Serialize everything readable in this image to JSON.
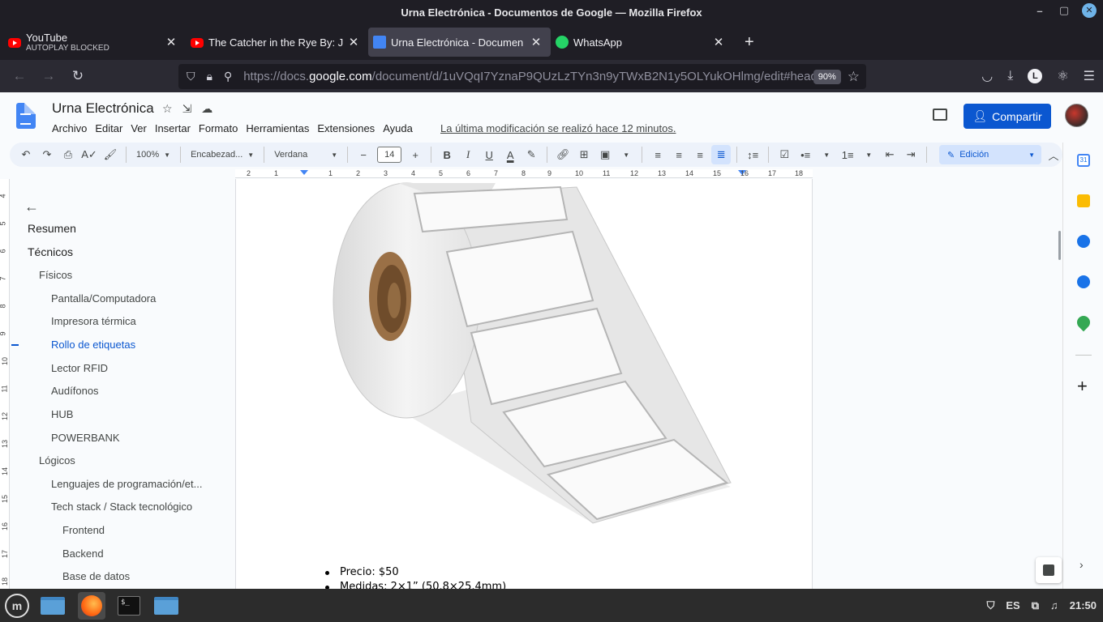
{
  "window": {
    "title": "Urna Electrónica - Documentos de Google — Mozilla Firefox"
  },
  "tabs": [
    {
      "title": "YouTube",
      "subtitle": "AUTOPLAY BLOCKED",
      "icon": "youtube-icon"
    },
    {
      "title": "The Catcher in the Rye By: J",
      "icon": "youtube-icon"
    },
    {
      "title": "Urna Electrónica - Documen",
      "icon": "google-docs-icon",
      "active": true
    },
    {
      "title": "WhatsApp",
      "icon": "whatsapp-icon"
    }
  ],
  "navbar": {
    "url_prefix": "https://docs.",
    "url_domain": "google.com",
    "url_rest": "/document/d/1uVQqI7YznaP9QUzLzTYn3n9yTWxB2N1y5OLYukOHlmg/edit#head",
    "zoom": "90%",
    "profile_initial": "L"
  },
  "docs": {
    "title": "Urna Electrónica",
    "menu": [
      "Archivo",
      "Editar",
      "Ver",
      "Insertar",
      "Formato",
      "Herramientas",
      "Extensiones",
      "Ayuda"
    ],
    "last_modified": "La última modificación se realizó hace 12 minutos.",
    "share_label": "Compartir"
  },
  "toolbar": {
    "zoom": "100%",
    "style": "Encabezad...",
    "font": "Verdana",
    "font_size": "14",
    "mode": "Edición"
  },
  "ruler": {
    "h_marks": [
      "2",
      "1",
      "1",
      "2",
      "3",
      "4",
      "5",
      "6",
      "7",
      "8",
      "9",
      "10",
      "11",
      "12",
      "13",
      "14",
      "15",
      "16",
      "17",
      "18"
    ],
    "v_marks": [
      "4",
      "5",
      "6",
      "7",
      "8",
      "9",
      "10",
      "11",
      "12",
      "13",
      "14",
      "15",
      "16",
      "17",
      "18"
    ]
  },
  "outline": {
    "items": [
      {
        "label": "Resumen",
        "level": 1
      },
      {
        "label": "Técnicos",
        "level": 1
      },
      {
        "label": "Físicos",
        "level": 2
      },
      {
        "label": "Pantalla/Computadora",
        "level": 3
      },
      {
        "label": "Impresora térmica",
        "level": 3
      },
      {
        "label": "Rollo de etiquetas",
        "level": 3,
        "selected": true
      },
      {
        "label": "Lector RFID",
        "level": 3
      },
      {
        "label": "Audífonos",
        "level": 3
      },
      {
        "label": "HUB",
        "level": 3
      },
      {
        "label": "POWERBANK",
        "level": 3
      },
      {
        "label": "Lógicos",
        "level": 2
      },
      {
        "label": "Lenguajes de programación/et...",
        "level": 3
      },
      {
        "label": "Tech stack / Stack tecnológico",
        "level": 3
      },
      {
        "label": "Frontend",
        "level": 4
      },
      {
        "label": "Backend",
        "level": 4
      },
      {
        "label": "Base de datos",
        "level": 4
      }
    ]
  },
  "document": {
    "bullets": [
      "Precio: $50",
      "Medidas: 2×1” (50.8×25.4mm)"
    ]
  },
  "side_panel": {
    "calendar_day": "31"
  },
  "taskbar": {
    "lang": "ES",
    "time": "21:50",
    "terminal_prompt": "$_"
  },
  "colors": {
    "accent": "#0b57d0",
    "share": "#0b57d0",
    "firefox_chrome": "#1f1e25"
  }
}
